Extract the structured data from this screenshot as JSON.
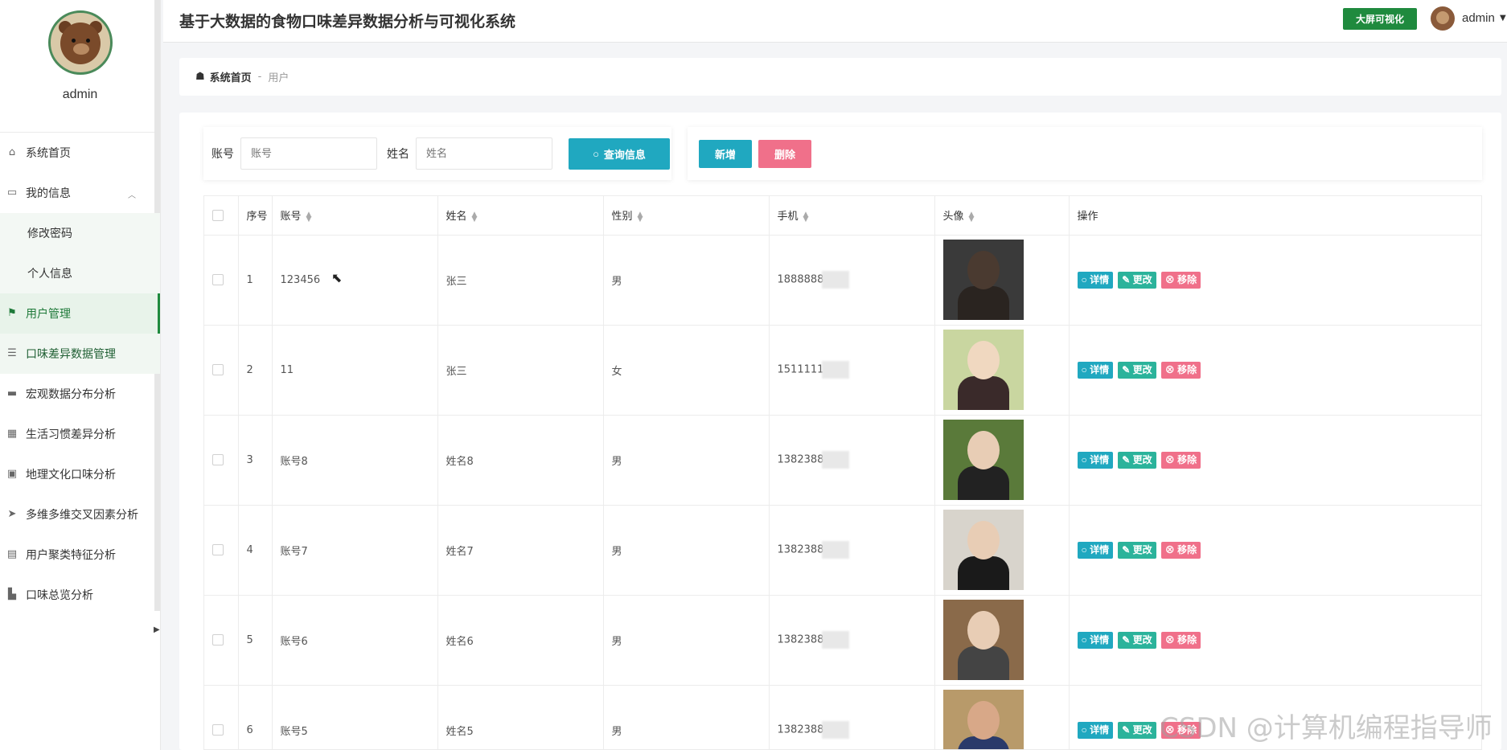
{
  "app": {
    "title": "基于大数据的食物口味差异数据分析与可视化系统",
    "screen_button": "大屏可视化",
    "user": "admin"
  },
  "sidebar": {
    "profile_name": "admin",
    "items": [
      {
        "label": "系统首页",
        "icon": "home-icon"
      },
      {
        "label": "我的信息",
        "icon": "card-icon"
      },
      {
        "label": "修改密码",
        "icon": ""
      },
      {
        "label": "个人信息",
        "icon": ""
      },
      {
        "label": "用户管理",
        "icon": "flag-icon"
      },
      {
        "label": "口味差异数据管理",
        "icon": "list-icon"
      },
      {
        "label": "宏观数据分布分析",
        "icon": "briefcase-icon"
      },
      {
        "label": "生活习惯差异分析",
        "icon": "grid-icon"
      },
      {
        "label": "地理文化口味分析",
        "icon": "printer-icon"
      },
      {
        "label": "多维多维交叉因素分析",
        "icon": "send-icon"
      },
      {
        "label": "用户聚类特征分析",
        "icon": "clipboard-icon"
      },
      {
        "label": "口味总览分析",
        "icon": "stamp-icon"
      }
    ]
  },
  "breadcrumb": {
    "home": "系统首页",
    "sep": "-",
    "current": "用户"
  },
  "search": {
    "account_label": "账号",
    "account_placeholder": "账号",
    "name_label": "姓名",
    "name_placeholder": "姓名",
    "search_button": "查询信息"
  },
  "actions": {
    "add": "新增",
    "delete": "删除"
  },
  "table": {
    "headers": [
      "序号",
      "账号",
      "姓名",
      "性别",
      "手机",
      "头像",
      "操作"
    ],
    "rows": [
      {
        "no": "1",
        "account": "123456",
        "name": "张三",
        "gender": "男",
        "phone": "1888888"
      },
      {
        "no": "2",
        "account": "11",
        "name": "张三",
        "gender": "女",
        "phone": "1511111"
      },
      {
        "no": "3",
        "account": "账号8",
        "name": "姓名8",
        "gender": "男",
        "phone": "1382388"
      },
      {
        "no": "4",
        "account": "账号7",
        "name": "姓名7",
        "gender": "男",
        "phone": "1382388"
      },
      {
        "no": "5",
        "account": "账号6",
        "name": "姓名6",
        "gender": "男",
        "phone": "1382388"
      },
      {
        "no": "6",
        "account": "账号5",
        "name": "姓名5",
        "gender": "男",
        "phone": "1382388"
      }
    ],
    "ops": {
      "detail": "详情",
      "edit": "更改",
      "remove": "移除"
    }
  },
  "watermark": "CSDN @计算机编程指导师",
  "colors": {
    "brand_green": "#1f8a3e",
    "info": "#20a8c0",
    "danger": "#f0708a",
    "teal": "#2bb39b"
  }
}
